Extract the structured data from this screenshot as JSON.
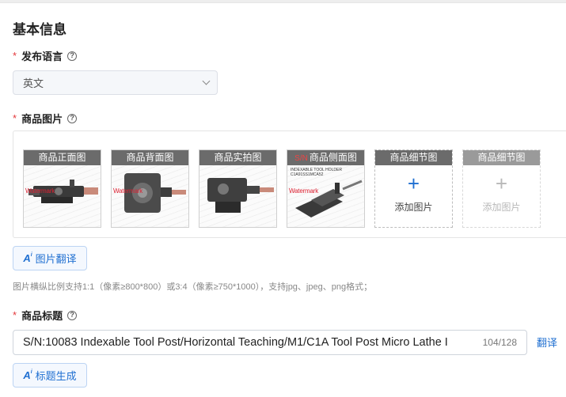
{
  "section": {
    "title": "基本信息"
  },
  "language": {
    "label": "发布语言",
    "required_mark": "*",
    "help_icon": "question-circle-icon",
    "selected": "英文"
  },
  "images": {
    "label": "商品图片",
    "required_mark": "*",
    "help_icon": "question-circle-icon",
    "slots": [
      {
        "caption": "商品正面图",
        "watermark": "Watermark",
        "filled": true
      },
      {
        "caption": "商品背面图",
        "watermark": "Watermark",
        "filled": true
      },
      {
        "caption": "商品实拍图",
        "watermark": "",
        "filled": true
      },
      {
        "caption": "商品侧面图",
        "overlay": "S/N",
        "watermark": "Watermark",
        "mini_text": "INDEXABLE TOOL HOLDER\nC1A91SS1MCA52",
        "filled": true
      },
      {
        "caption": "商品细节图",
        "add_label": "添加图片",
        "filled": false,
        "enabled": true
      },
      {
        "caption": "商品细节图",
        "add_label": "添加图片",
        "filled": false,
        "enabled": false
      }
    ],
    "translate_button": {
      "icon": "ai",
      "label": "图片翻译"
    },
    "hint": "图片横纵比例支持1:1（像素≥800*800）或3:4（像素≥750*1000），支持jpg、jpeg、png格式；"
  },
  "product_title": {
    "label": "商品标题",
    "required_mark": "*",
    "help_icon": "question-circle-icon",
    "value": "S/N:10083 Indexable Tool Post/Horizontal  Teaching/M1/C1A Tool Post Micro Lathe I",
    "counter": "104/128",
    "translate_link": "翻译",
    "generate_button": {
      "icon": "ai",
      "label": "标题生成"
    }
  },
  "colors": {
    "accent": "#1f6fd1",
    "required": "#e4393c",
    "caption_bg": "#6b6b6b"
  }
}
